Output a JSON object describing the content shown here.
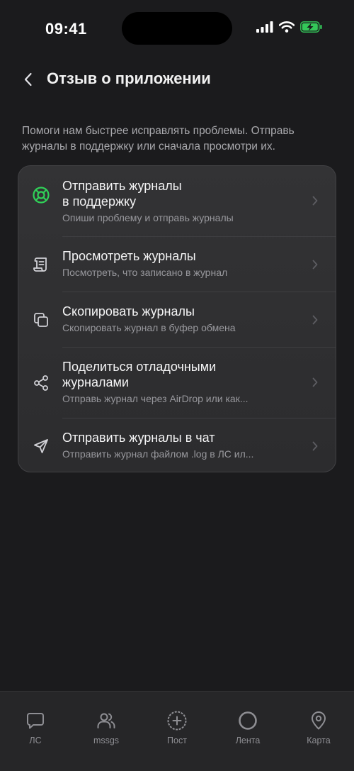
{
  "status_bar": {
    "time": "09:41"
  },
  "header": {
    "title": "Отзыв о приложении"
  },
  "description": "Помоги нам быстрее исправлять проблемы. Отправь журналы в поддержку или сначала просмотри их.",
  "menu": {
    "items": [
      {
        "title": "Отправить журналы\nв поддержку",
        "subtitle": "Опиши проблему и отправь журналы",
        "icon": "lifebuoy-icon",
        "accent": "#30d158"
      },
      {
        "title": "Просмотреть журналы",
        "subtitle": "Посмотреть, что записано в журнал",
        "icon": "scroll-icon"
      },
      {
        "title": "Скопировать журналы",
        "subtitle": "Скопировать журнал в буфер обмена",
        "icon": "copy-icon"
      },
      {
        "title": "Поделиться отладочными\nжурналами",
        "subtitle": "Отправь журнал через AirDrop или как...",
        "icon": "share-icon"
      },
      {
        "title": "Отправить журналы в чат",
        "subtitle": "Отправить журнал файлом .log в ЛС ил...",
        "icon": "send-icon"
      }
    ]
  },
  "tab_bar": {
    "tabs": [
      {
        "label": "ЛС",
        "icon": "chat-bubble-icon"
      },
      {
        "label": "mssgs",
        "icon": "people-icon"
      },
      {
        "label": "Пост",
        "icon": "plus-circle-icon"
      },
      {
        "label": "Лента",
        "icon": "ring-icon"
      },
      {
        "label": "Карта",
        "icon": "location-pin-icon"
      }
    ]
  },
  "colors": {
    "background": "#1b1b1d",
    "card": "#2f2f31",
    "accent": "#30d158",
    "battery": "#34c759"
  }
}
